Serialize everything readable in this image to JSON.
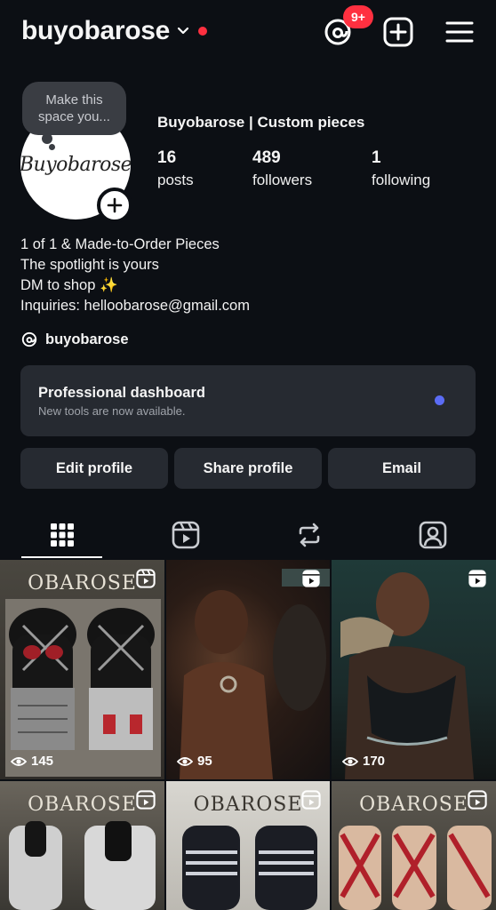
{
  "topbar": {
    "username": "buyobarose",
    "notification_badge": "9+",
    "icons": [
      "chevron-down-icon",
      "threads-icon",
      "add-icon",
      "menu-icon"
    ],
    "accent_red": "#ff3040"
  },
  "profile": {
    "note": "Make this space you...",
    "avatar_text": "Buyobarose",
    "display_name": "Buyobarose | Custom pieces",
    "stats": {
      "posts": {
        "value": "16",
        "label": "posts"
      },
      "followers": {
        "value": "489",
        "label": "followers"
      },
      "following": {
        "value": "1",
        "label": "following"
      }
    },
    "bio": [
      "1 of 1 & Made-to-Order Pieces",
      "The spotlight is yours",
      "DM to shop ✨",
      "Inquiries: helloobarose@gmail.com"
    ],
    "threads_handle": "buyobarose"
  },
  "dashboard": {
    "title": "Professional dashboard",
    "subtitle": "New tools are now available.",
    "dot_color": "#5b6cf5"
  },
  "buttons": {
    "edit": "Edit profile",
    "share": "Share profile",
    "email": "Email"
  },
  "tabs": [
    "grid-icon",
    "reels-icon",
    "reposts-icon",
    "tagged-icon"
  ],
  "posts": [
    {
      "views": "145",
      "sign": "OBAROSE"
    },
    {
      "views": "95",
      "sign": ""
    },
    {
      "views": "170",
      "sign": ""
    },
    {
      "views": "",
      "sign": "OBAROSE"
    },
    {
      "views": "",
      "sign": "OBAROSE"
    },
    {
      "views": "",
      "sign": "OBAROSE"
    }
  ]
}
